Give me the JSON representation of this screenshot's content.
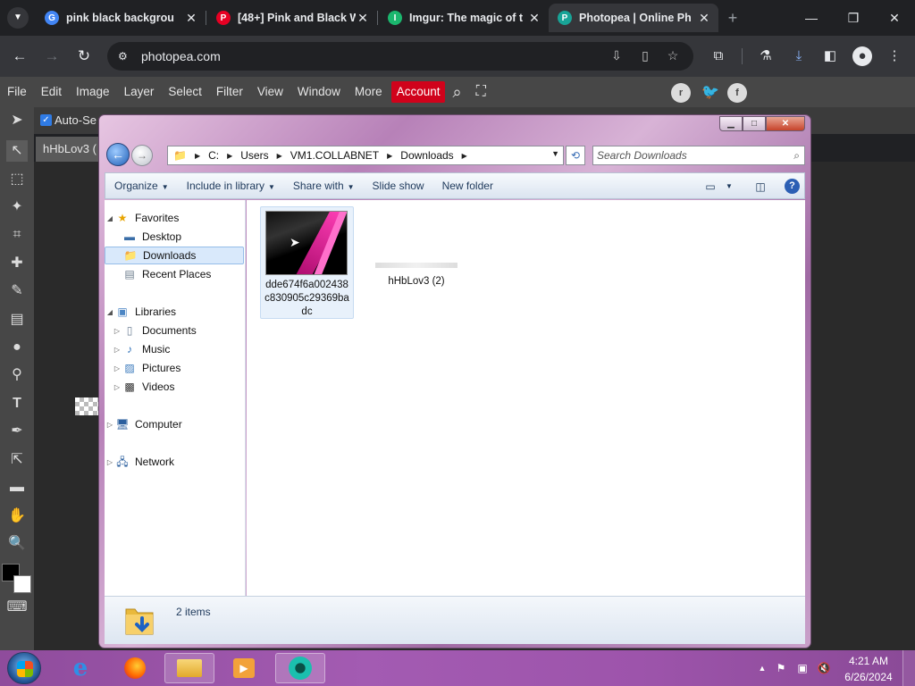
{
  "browser": {
    "tabs": [
      {
        "title": "pink black backgrou",
        "favicon": "G",
        "favicon_color": "#ffffff",
        "favicon_bg": "#4285f4"
      },
      {
        "title": "[48+] Pink and Black W",
        "favicon": "P",
        "favicon_color": "#ffffff",
        "favicon_bg": "#e60023"
      },
      {
        "title": "Imgur: The magic of t",
        "favicon": "I",
        "favicon_color": "#ffffff",
        "favicon_bg": "#1bb76e"
      },
      {
        "title": "Photopea | Online Ph",
        "favicon": "P",
        "favicon_color": "#ffffff",
        "favicon_bg": "#18a497"
      }
    ],
    "active_tab": 3,
    "url": "photopea.com"
  },
  "photopea": {
    "menus": [
      "File",
      "Edit",
      "Image",
      "Layer",
      "Select",
      "Filter",
      "View",
      "Window",
      "More"
    ],
    "account_label": "Account",
    "auto_select_label": "Auto-Se",
    "doc_tab": "hHbLov3 (",
    "accent": "#d0021b"
  },
  "explorer": {
    "breadcrumb": [
      "C:",
      "Users",
      "VM1.COLLABNET",
      "Downloads"
    ],
    "search_placeholder": "Search Downloads",
    "commands": [
      "Organize",
      "Include in library",
      "Share with",
      "Slide show",
      "New folder"
    ],
    "nav": {
      "favorites_label": "Favorites",
      "favorites": [
        "Desktop",
        "Downloads",
        "Recent Places"
      ],
      "selected": "Downloads",
      "libraries_label": "Libraries",
      "libraries": [
        "Documents",
        "Music",
        "Pictures",
        "Videos"
      ],
      "computer_label": "Computer",
      "network_label": "Network"
    },
    "files": [
      {
        "name": "dde674f6a002438c830905c29369badc"
      },
      {
        "name": "hHbLov3 (2)"
      }
    ],
    "status_count": "2 items"
  },
  "taskbar": {
    "time": "4:21 AM",
    "date": "6/26/2024"
  }
}
